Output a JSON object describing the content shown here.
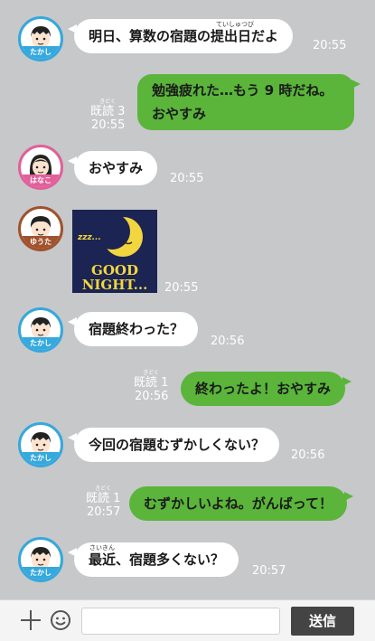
{
  "messages": [
    {
      "sender": "たかし",
      "text": "明日、算数の宿題の提出日だよ",
      "ruby": "ていしゅつび",
      "time": "20:55"
    },
    {
      "sender": "me",
      "line1": "勉強疲れた…もう 9 時だね。",
      "line2": "おやすみ",
      "read": "既読 3",
      "read_kana": "きどく",
      "time": "20:55"
    },
    {
      "sender": "はなこ",
      "text": "おやすみ",
      "time": "20:55"
    },
    {
      "sender": "ゆうた",
      "sticker": {
        "zzz": "zzz...",
        "line1": "GOOD",
        "line2": "NIGHT..."
      },
      "time": "20:55"
    },
    {
      "sender": "たかし",
      "text": "宿題終わった？",
      "time": "20:56"
    },
    {
      "sender": "me",
      "text": "終わったよ！おやすみ",
      "read": "既読 1",
      "read_kana": "きどく",
      "time": "20:56"
    },
    {
      "sender": "たかし",
      "text": "今回の宿題むずかしくない？",
      "time": "20:56"
    },
    {
      "sender": "me",
      "text": "むずかしいよね。がんばって！",
      "read": "既読 1",
      "read_kana": "きどく",
      "time": "20:57"
    },
    {
      "sender": "たかし",
      "text": "最近、宿題多くない？",
      "ruby": "さいきん",
      "time": "20:57"
    }
  ],
  "input": {
    "placeholder": "",
    "value": ""
  },
  "send_label": "送信",
  "colors": {
    "background": "#c7c8ca",
    "outgoing": "#5ab53a",
    "incoming": "#ffffff",
    "takashi": "#35a8dc",
    "hanako": "#e0609a",
    "yuta": "#a0522d"
  }
}
